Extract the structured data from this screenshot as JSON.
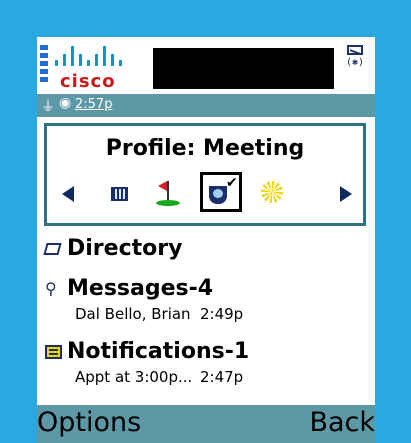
{
  "header": {
    "logo_text": "cisco",
    "status_icon_text": "(✱)"
  },
  "statusbar": {
    "time": "2:57p"
  },
  "profile": {
    "title": "Profile: Meeting",
    "icons": [
      "building-icon",
      "golf-icon",
      "coffee-cup-icon",
      "sun-icon"
    ],
    "selected": "coffee-cup-icon"
  },
  "list": {
    "items": [
      {
        "title": "Directory"
      },
      {
        "title": "Messages-4",
        "subtitle": "Dal Bello, Brian",
        "time": "2:49p"
      },
      {
        "title": "Notifications-1",
        "subtitle": "Appt at 3:00p...",
        "time": "2:47p"
      }
    ]
  },
  "softkeys": {
    "left": "Options",
    "right": "Back"
  },
  "colors": {
    "background": "#2aa8df",
    "bar": "#5c98a6",
    "profile_border": "#2e7180",
    "logo_red": "#cc1a1a"
  }
}
